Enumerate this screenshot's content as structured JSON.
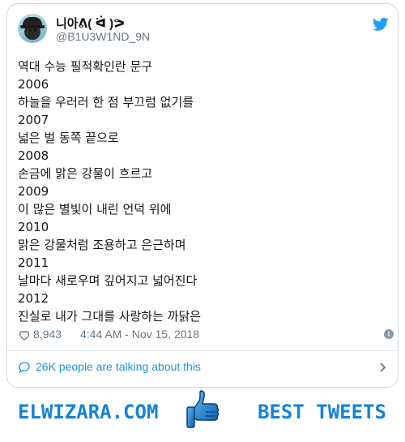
{
  "user": {
    "display_name": "니아ᕕ( ᐛ )ᕗ",
    "handle": "@B1U3W1ND_9N"
  },
  "tweet": {
    "lines": [
      "역대 수능 필적확인란 문구",
      "2006",
      "하늘을 우러러 한 점 부끄럼 없기를",
      "2007",
      "넓은 벌 동쪽 끝으로",
      "2008",
      "손금에 맑은 강물이 흐르고",
      "2009",
      "이 많은 별빛이 내린 언덕 위에",
      "2010",
      "맑은 강물처럼 조용하고 은근하며",
      "2011",
      "날마다 새로우며 깊어지고 넓어진다",
      "2012",
      "진실로 내가 그대를 사랑하는 까닭은"
    ]
  },
  "meta": {
    "likes": "8,943",
    "timestamp": "4:44 AM - Nov 15, 2018",
    "info_glyph": "i"
  },
  "talking": {
    "label": "26K people are talking about this"
  },
  "banner": {
    "left_text": "ELWIZARA.COM",
    "right_text": "BEST TWEETS"
  },
  "colors": {
    "twitter_blue": "#1da1f2",
    "link_blue": "#1b95e0",
    "brand_blue": "#1583d6",
    "muted": "#657786"
  }
}
